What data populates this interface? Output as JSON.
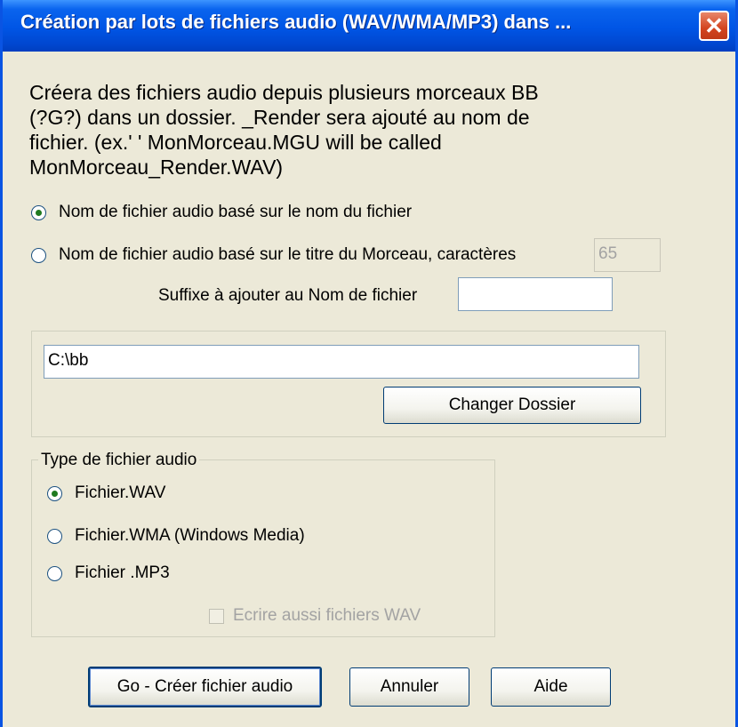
{
  "window": {
    "title": "Création par lots de fichiers audio (WAV/WMA/MP3) dans ...",
    "close_glyph": "✕"
  },
  "intro": {
    "lines": [
      "Créera des fichiers audio depuis plusieurs morceaux BB",
      "(?G?) dans un dossier.  _Render sera ajouté au nom de",
      "fichier. (ex.'        ' MonMorceau.MGU will be called",
      "MonMorceau_Render.WAV)"
    ]
  },
  "naming": {
    "option_filename": "Nom de fichier audio basé sur le nom du fichier",
    "option_title": "Nom de fichier audio basé sur le titre du  Morceau,  caractères",
    "chars_value": "65",
    "suffix_label": "Suffixe à ajouter au Nom de fichier",
    "suffix_value": ""
  },
  "folder": {
    "path_value": "C:\\bb",
    "change_button": "Changer Dossier"
  },
  "audio_type": {
    "legend": "Type de fichier audio",
    "wav": "Fichier.WAV",
    "wma": "Fichier.WMA  (Windows Media)",
    "mp3": "Fichier .MP3",
    "also_wav": "Ecrire aussi fichiers WAV"
  },
  "buttons": {
    "go": "Go - Créer fichier audio",
    "cancel": "Annuler",
    "help": "Aide"
  },
  "colors": {
    "titlebar": "#0055e5",
    "dialog_bg": "#ece9d8",
    "close_button": "#d3441f"
  }
}
